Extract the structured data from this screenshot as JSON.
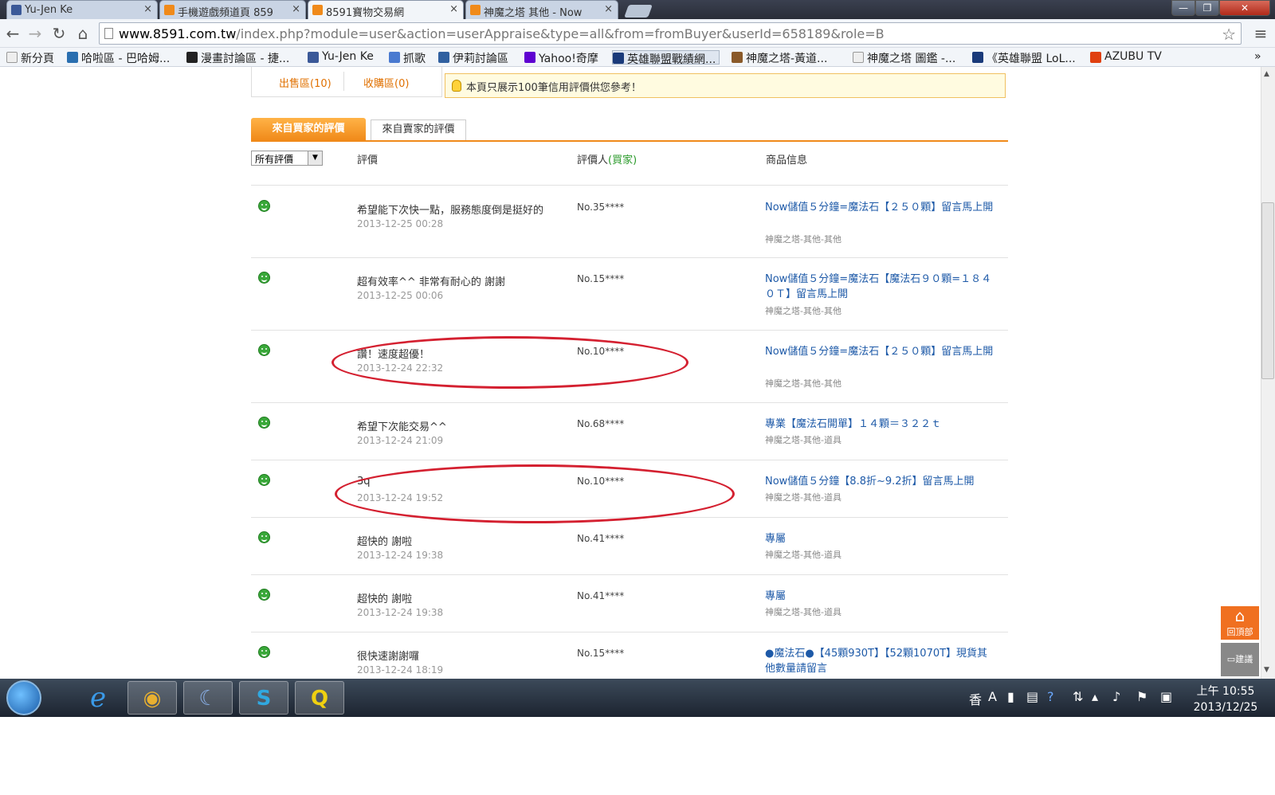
{
  "browser": {
    "tabs": [
      {
        "label": "Yu-Jen Ke",
        "icon": "facebook-icon",
        "color": "#3b5998",
        "active": false
      },
      {
        "label": "手機遊戲頻道頁 859",
        "icon": "8591-icon",
        "color": "#f08a1a",
        "active": false
      },
      {
        "label": "8591寶物交易網",
        "icon": "8591-icon",
        "color": "#f08a1a",
        "active": true
      },
      {
        "label": "神魔之塔 其他 - Now",
        "icon": "8591-icon",
        "color": "#f08a1a",
        "active": false
      }
    ],
    "url_domain": "www.8591.com.tw",
    "url_path": "/index.php?module=user&action=userAppraise&type=all&from=fromBuyer&userId=658189&role=B",
    "bookmarks": [
      {
        "label": "新分頁",
        "icon": "page-icon",
        "color": "#ccc"
      },
      {
        "label": "哈啦區 - 巴哈姆...",
        "icon": "bahamut-icon",
        "color": "#2a6fb0"
      },
      {
        "label": "漫畫討論區 - 捷...",
        "icon": "comic-icon",
        "color": "#222"
      },
      {
        "label": "Yu-Jen Ke",
        "icon": "facebook-icon",
        "color": "#3b5998"
      },
      {
        "label": "抓歌",
        "icon": "music-icon",
        "color": "#4a7ad0"
      },
      {
        "label": "伊莉討論區",
        "icon": "forum-icon",
        "color": "#3060a0"
      },
      {
        "label": "Yahoo!奇摩",
        "icon": "yahoo-icon",
        "color": "#5f01d1"
      },
      {
        "label": "英雄聯盟戰績網...",
        "icon": "lol-icon",
        "color": "#1a3a7a"
      },
      {
        "label": "神魔之塔-黃道...",
        "icon": "tos-icon",
        "color": "#8a5a2a"
      },
      {
        "label": "神魔之塔 圖鑑 -...",
        "icon": "page-icon",
        "color": "#ccc"
      },
      {
        "label": "《英雄聯盟 LoL...",
        "icon": "lol-icon",
        "color": "#1a3a7a"
      },
      {
        "label": "AZUBU TV",
        "icon": "azubu-icon",
        "color": "#e04010"
      }
    ]
  },
  "page": {
    "zones": {
      "sell": "出售區(10)",
      "buy": "收購區(0)"
    },
    "notice": "本頁只展示100筆信用評價供您參考！",
    "tabs": {
      "from_buyer": "來自買家的評價",
      "from_seller": "來自賣家的評價"
    },
    "filter": "所有評價",
    "headers": {
      "comment": "評價",
      "rater": "評價人",
      "rater_role": "(買家)",
      "product": "商品信息"
    },
    "rows": [
      {
        "comment": "希望能下次快一點，服務態度倒是挺好的",
        "date": "2013-12-25 00:28",
        "rater": "No.35****",
        "product": "Now儲值５分鐘=魔法石【２５０顆】留言馬上開",
        "category": "神魔之塔-其他-其他"
      },
      {
        "comment": "超有效率^^ 非常有耐心的 謝謝",
        "date": "2013-12-25 00:06",
        "rater": "No.15****",
        "product": "Now儲值５分鐘=魔法石【魔法石９０顆=１８４０Ｔ】留言馬上開",
        "category": "神魔之塔-其他-其他"
      },
      {
        "comment": "讚！速度超優！",
        "date": "2013-12-24 22:32",
        "rater": "No.10****",
        "product": "Now儲值５分鐘=魔法石【２５０顆】留言馬上開",
        "category": "神魔之塔-其他-其他"
      },
      {
        "comment": "希望下次能交易^^",
        "date": "2013-12-24 21:09",
        "rater": "No.68****",
        "product": "專業【魔法石開單】１４顆＝３２２ｔ",
        "category": "神魔之塔-其他-道具"
      },
      {
        "comment": "3q",
        "date": "2013-12-24 19:52",
        "rater": "No.10****",
        "product": "Now儲值５分鐘【8.8折~9.2折】留言馬上開",
        "category": "神魔之塔-其他-道具"
      },
      {
        "comment": "超快的 謝啦",
        "date": "2013-12-24 19:38",
        "rater": "No.41****",
        "product": "專屬",
        "category": "神魔之塔-其他-道具"
      },
      {
        "comment": "超快的 謝啦",
        "date": "2013-12-24 19:38",
        "rater": "No.41****",
        "product": "專屬",
        "category": "神魔之塔-其他-道具"
      },
      {
        "comment": "很快速謝謝囉",
        "date": "2013-12-24 18:19",
        "rater": "No.15****",
        "product": "●魔法石●【45顆930T】【52顆1070T】現貨其他數量請留言",
        "category": ""
      }
    ],
    "side_buttons": {
      "back_to_top": "回頂部",
      "suggest": "建議"
    }
  },
  "taskbar": {
    "apps": [
      {
        "name": "internet-explorer",
        "glyph": "e"
      },
      {
        "name": "chrome",
        "glyph": "◉"
      },
      {
        "name": "moon-app",
        "glyph": "☾"
      },
      {
        "name": "skype",
        "glyph": "S"
      },
      {
        "name": "app-q",
        "glyph": "Q"
      }
    ],
    "time": "上午 10:55",
    "date": "2013/12/25"
  }
}
